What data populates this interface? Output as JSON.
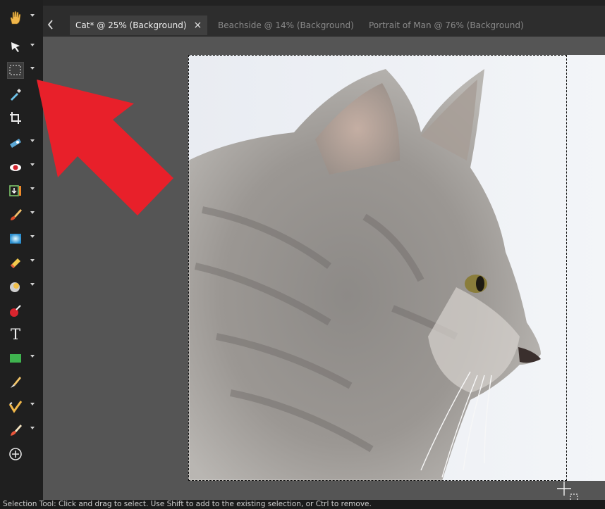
{
  "tabs": [
    {
      "label": "Cat* @  25% (Background)",
      "active": true,
      "close": "×"
    },
    {
      "label": "Beachside @  14% (Background)",
      "active": false
    },
    {
      "label": "Portrait of Man @  76% (Background)",
      "active": false
    }
  ],
  "tools": [
    {
      "name": "pan-tool",
      "icon": "hand-icon",
      "dropdown": true
    },
    {
      "name": "pick-tool",
      "icon": "pointer-arrow-icon",
      "dropdown": true
    },
    {
      "name": "selection-tool",
      "icon": "marquee-selection-icon",
      "dropdown": true,
      "active": true
    },
    {
      "name": "dropper-tool",
      "icon": "eyedropper-icon",
      "dropdown": false
    },
    {
      "name": "crop-tool",
      "icon": "crop-icon",
      "dropdown": false
    },
    {
      "name": "straighten-tool",
      "icon": "straighten-icon",
      "dropdown": true
    },
    {
      "name": "red-eye-tool",
      "icon": "eye-icon",
      "dropdown": true
    },
    {
      "name": "makeover-tool",
      "icon": "makeover-icon",
      "dropdown": true
    },
    {
      "name": "paint-brush-tool",
      "icon": "paintbrush-icon",
      "dropdown": true
    },
    {
      "name": "fill-tool",
      "icon": "gradient-fill-icon",
      "dropdown": true
    },
    {
      "name": "eraser-tool",
      "icon": "eraser-icon",
      "dropdown": true
    },
    {
      "name": "dodge-tool",
      "icon": "dodge-icon",
      "dropdown": true
    },
    {
      "name": "color-replacer-tool",
      "icon": "color-replacer-icon",
      "dropdown": false
    },
    {
      "name": "text-tool",
      "icon": "text-icon",
      "dropdown": false
    },
    {
      "name": "shape-tool",
      "icon": "rectangle-shape-icon",
      "dropdown": true
    },
    {
      "name": "pen-tool",
      "icon": "pen-icon",
      "dropdown": false
    },
    {
      "name": "brush-variance-tool",
      "icon": "brush-variance-icon",
      "dropdown": true
    },
    {
      "name": "clone-tool",
      "icon": "clone-brush-icon",
      "dropdown": true
    },
    {
      "name": "add-tool",
      "icon": "plus-circle-icon",
      "dropdown": false
    }
  ],
  "text_tool_glyph": "T",
  "status": {
    "message": "Selection Tool: Click and drag to select. Use Shift to add to the existing selection, or Ctrl to remove."
  },
  "colors": {
    "annotation_arrow": "#e8202a",
    "canvas_bg": "#555555",
    "toolbar_bg": "#1f1f1f"
  }
}
